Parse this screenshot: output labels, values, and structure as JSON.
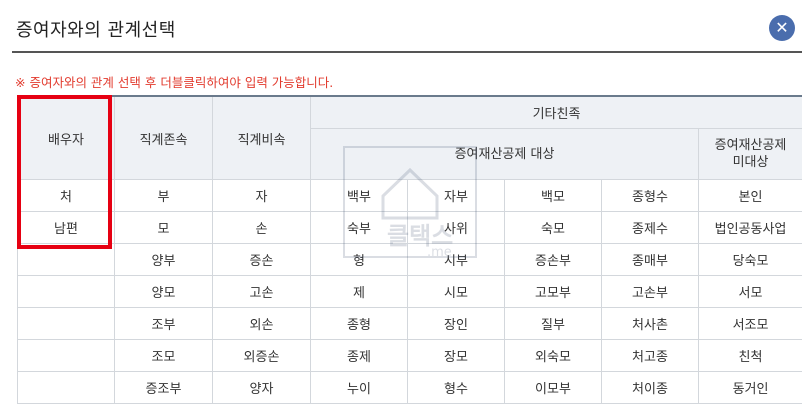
{
  "dialog": {
    "title": "증여자와의 관계선택",
    "close_icon": "close-icon",
    "notice": "※ 증여자와의 관계 선택 후 더블클릭하여야 입력 가능합니다."
  },
  "table": {
    "headers": {
      "spouse": "배우자",
      "lineal_ascendant": "직계존속",
      "lineal_descendant": "직계비속",
      "other_relatives": "기타친족",
      "deduction_target": "증여재산공제 대상",
      "non_deduction_line1": "증여재산공제",
      "non_deduction_line2": "미대상"
    },
    "rows": [
      [
        "처",
        "부",
        "자",
        "백부",
        "자부",
        "백모",
        "종형수",
        "본인"
      ],
      [
        "남편",
        "모",
        "손",
        "숙부",
        "사위",
        "숙모",
        "종제수",
        "법인공동사업"
      ],
      [
        "",
        "양부",
        "증손",
        "형",
        "시부",
        "증손부",
        "종매부",
        "당숙모"
      ],
      [
        "",
        "양모",
        "고손",
        "제",
        "시모",
        "고모부",
        "고손부",
        "서모"
      ],
      [
        "",
        "조부",
        "외손",
        "종형",
        "장인",
        "질부",
        "처사촌",
        "서조모"
      ],
      [
        "",
        "조모",
        "외증손",
        "종제",
        "장모",
        "외숙모",
        "처고종",
        "친척"
      ],
      [
        "",
        "증조부",
        "양자",
        "누이",
        "형수",
        "이모부",
        "처이종",
        "동거인"
      ]
    ]
  },
  "watermark": {
    "text_main": "클택스",
    "text_sub": ".me"
  },
  "colors": {
    "accent": "#4a6dad",
    "notice": "#e23b2e",
    "highlight_box": "#e60012",
    "header_bg": "#eef1f5"
  }
}
